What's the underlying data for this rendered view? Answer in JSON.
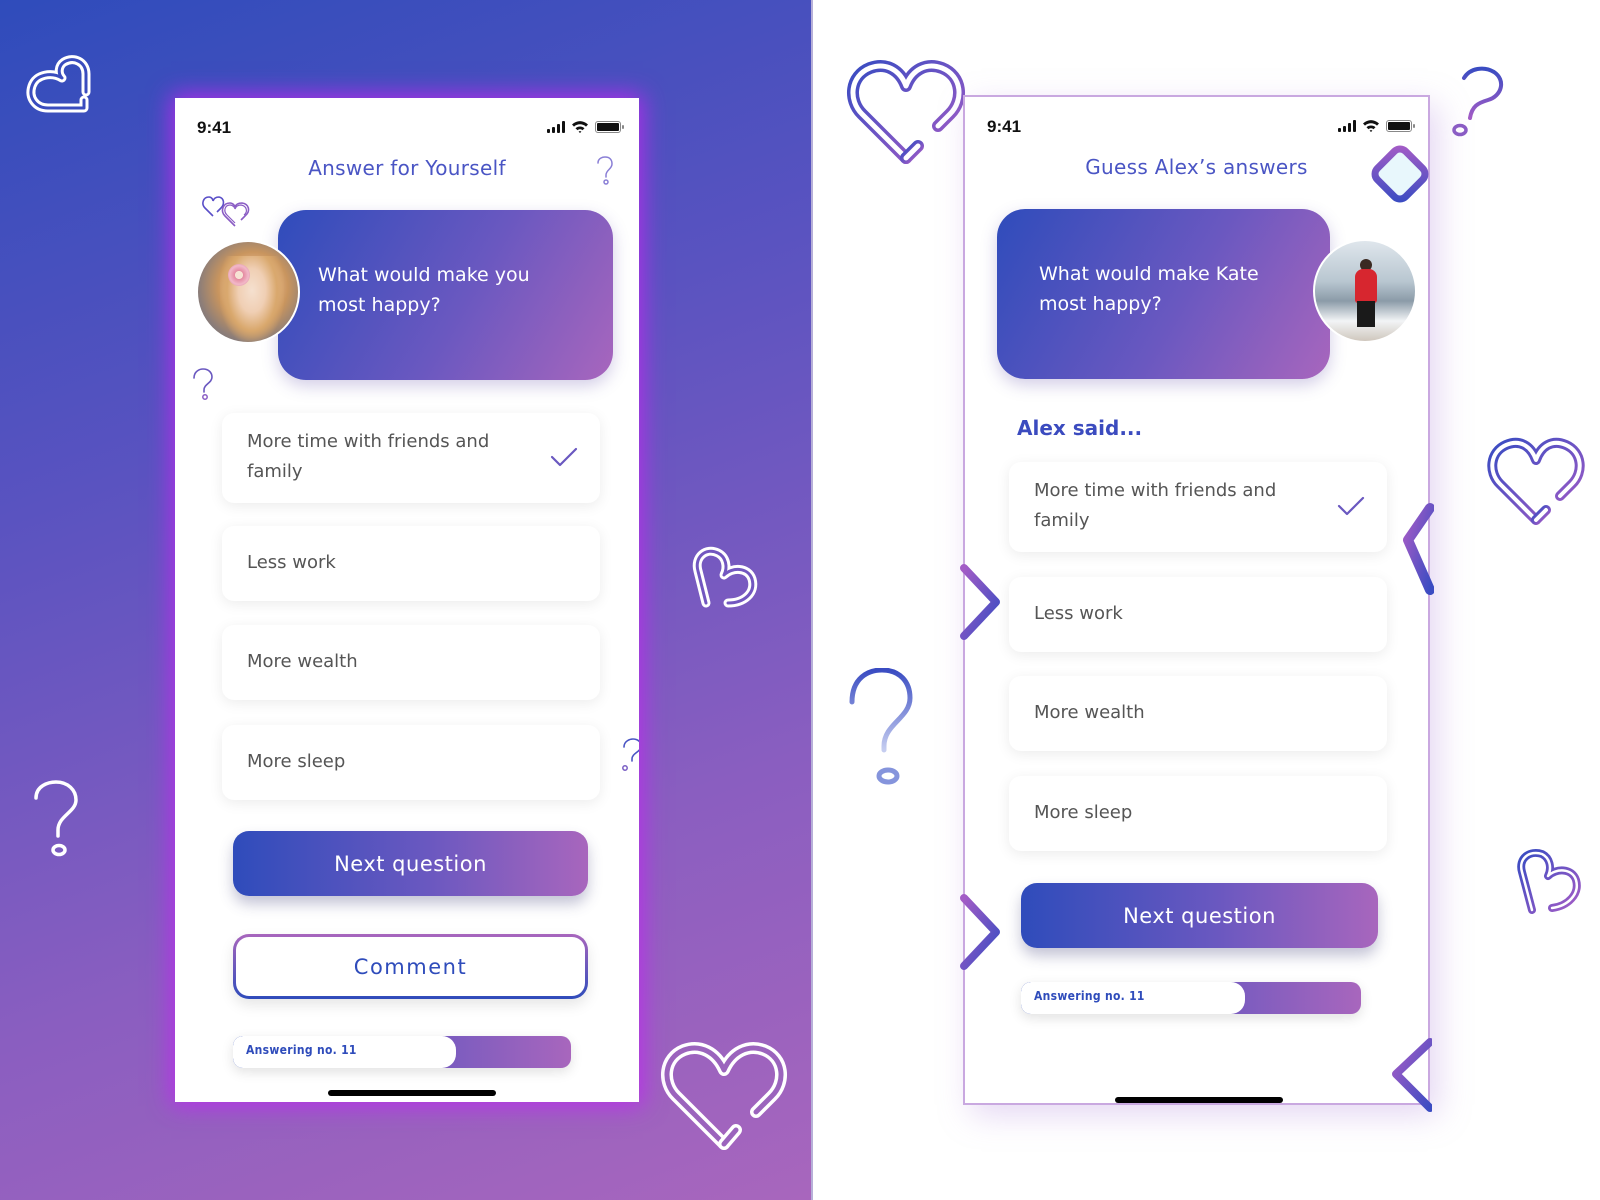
{
  "left_screen": {
    "status_time": "9:41",
    "title": "Answer for Yourself",
    "question": "What would make you most happy?",
    "question_lines": [
      "What would make you",
      "most happy?"
    ],
    "options": [
      {
        "label_lines": [
          "More time with friends and",
          "family"
        ],
        "selected": true
      },
      {
        "label_lines": [
          "Less work"
        ],
        "selected": false
      },
      {
        "label_lines": [
          "More wealth"
        ],
        "selected": false
      },
      {
        "label_lines": [
          "More sleep"
        ],
        "selected": false
      }
    ],
    "next_button": "Next question",
    "comment_button": "Comment",
    "progress_label": "Answering no. 11",
    "progress_fraction": 0.66
  },
  "right_screen": {
    "status_time": "9:41",
    "title": "Guess Alex’s answers",
    "question_lines": [
      "What would make Kate",
      "most happy?"
    ],
    "section_label": "Alex said...",
    "options": [
      {
        "label_lines": [
          "More time with friends and",
          "family"
        ],
        "selected": true
      },
      {
        "label_lines": [
          "Less work"
        ],
        "selected": false
      },
      {
        "label_lines": [
          "More wealth"
        ],
        "selected": false
      },
      {
        "label_lines": [
          "More sleep"
        ],
        "selected": false
      }
    ],
    "next_button": "Next question",
    "progress_label": "Answering no. 11",
    "progress_fraction": 0.66
  },
  "colors": {
    "accent_blue": "#2f4cbb",
    "accent_purple": "#6a58c0",
    "accent_pink": "#a866bd",
    "title_blue": "#4a55c4",
    "glow": "#be28f0"
  }
}
